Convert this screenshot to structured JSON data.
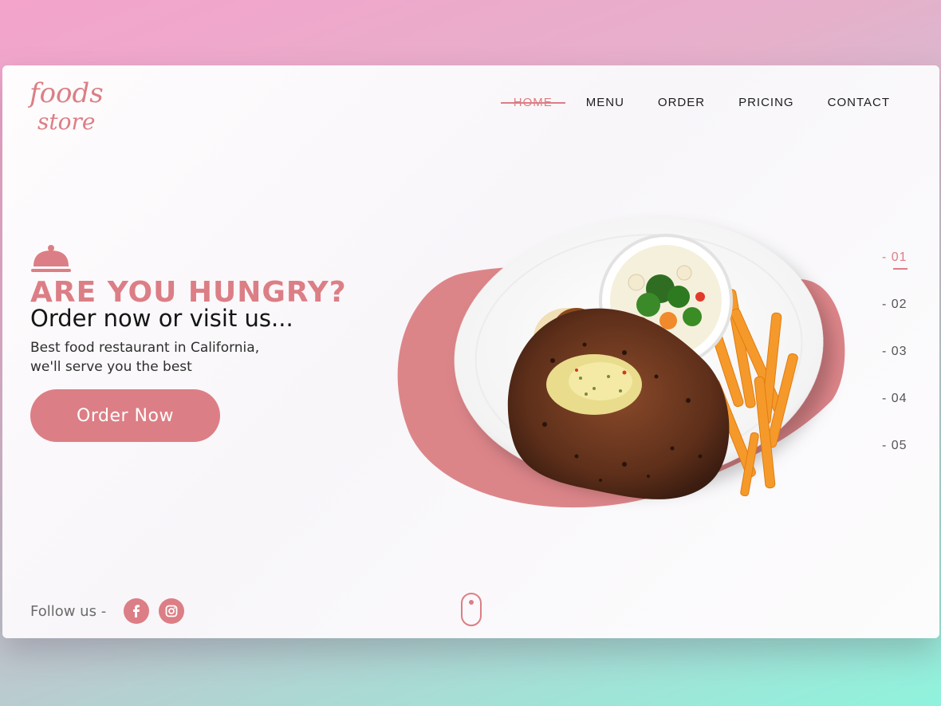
{
  "brand": {
    "line1": "foods",
    "line2": "store",
    "color": "#dc7e85"
  },
  "nav": {
    "items": [
      {
        "label": "HOME",
        "active": true
      },
      {
        "label": "MENU"
      },
      {
        "label": "ORDER"
      },
      {
        "label": "PRICING"
      },
      {
        "label": "CONTACT"
      }
    ]
  },
  "hero": {
    "headline": "ARE YOU HUNGRY?",
    "subhead": "Order now or visit us...",
    "description_line1": "Best food restaurant in California,",
    "description_line2": "we'll serve you the best",
    "cta_label": "Order Now",
    "icon": "cloche-icon",
    "image": "steak-plate-image"
  },
  "pager": {
    "items": [
      "- 01",
      "- 02",
      "- 03",
      "- 04",
      "- 05"
    ],
    "active_index": 0
  },
  "footer": {
    "follow_label": "Follow us -",
    "social": [
      "facebook-icon",
      "instagram-icon"
    ],
    "scroll_indicator": "mouse-scroll-icon"
  },
  "colors": {
    "accent": "#dc7e85",
    "text_dark": "#151515",
    "background_top": "#f4a3cb",
    "background_bottom": "#8ff3dc"
  }
}
